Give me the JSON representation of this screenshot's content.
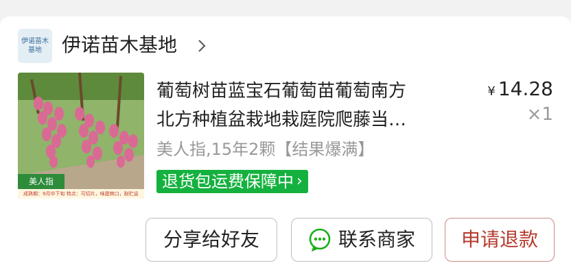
{
  "store": {
    "logo_line1": "伊诺苗木",
    "logo_line2": "基地",
    "name": "伊诺苗木基地",
    "chevron_icon": "chevron-right-icon"
  },
  "product": {
    "title_line1": "葡萄树苗蓝宝石葡萄苗葡萄南方",
    "title_line2": "北方种植盆栽地栽庭院爬藤当…",
    "price_symbol": "¥",
    "price": "14.28",
    "quantity": "×1",
    "spec": "美人指,15年2颗【结果爆满】",
    "badge": "退货包运费保障中",
    "thumb_tag": "美人指",
    "thumb_caption": "成熟期：9月中下旬    特点：可切片，味甜爽口，耐贮运"
  },
  "actions": {
    "share": "分享给好友",
    "contact": "联系商家",
    "refund": "申请退款"
  },
  "colors": {
    "badge_green": "#15b13f",
    "refund_red": "#b53a2e",
    "wechat_green": "#1aad19"
  }
}
